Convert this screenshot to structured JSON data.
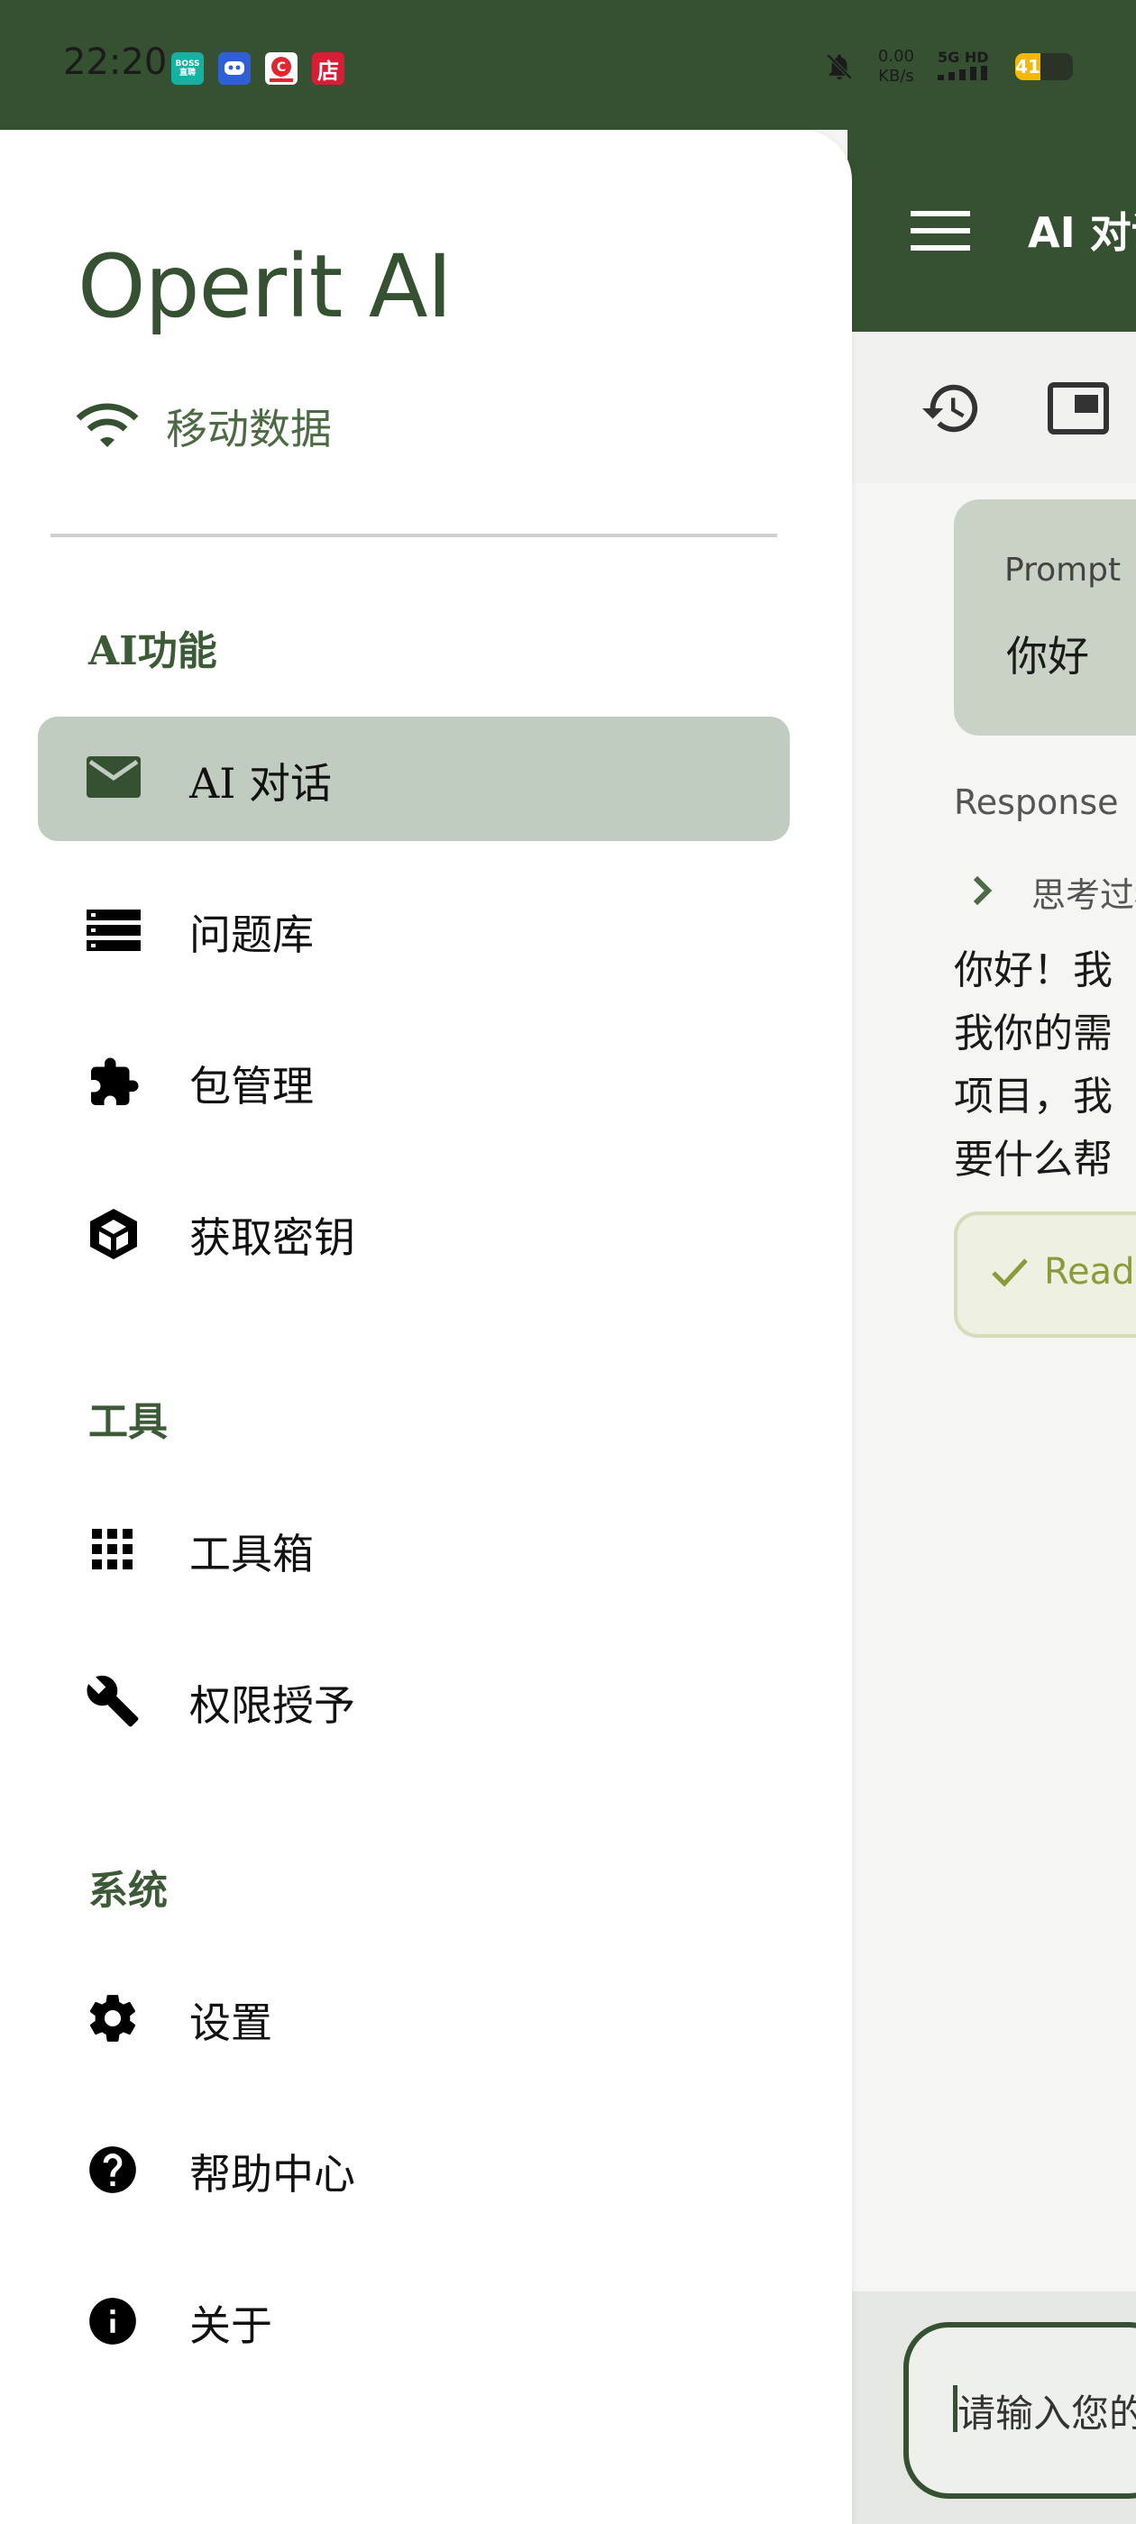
{
  "status_bar": {
    "time": "22:20",
    "apps": [
      {
        "name": "boss-app",
        "label": "BOSS 直聘",
        "color": "#12b3a3"
      },
      {
        "name": "bot-app",
        "label": "",
        "color": "#2f5fd6"
      },
      {
        "name": "red-app",
        "label": "",
        "color": "#e0262e"
      },
      {
        "name": "store-app",
        "label": "店",
        "color": "#d81e34"
      }
    ],
    "net_speed_value": "0.00",
    "net_speed_unit": "KB/s",
    "signal_label": "5G HD",
    "battery_level": "41",
    "icons": {
      "mute": "bell-off-icon",
      "signal": "signal-bars-icon",
      "battery": "battery-icon"
    }
  },
  "drawer": {
    "title": "Operit AI",
    "network": {
      "label": "移动数据",
      "icon": "wifi-icon"
    },
    "sections": [
      {
        "header": "AI功能",
        "items": [
          {
            "label": "AI 对话",
            "icon": "mail-icon",
            "active": true
          },
          {
            "label": "问题库",
            "icon": "storage-icon",
            "active": false
          },
          {
            "label": "包管理",
            "icon": "puzzle-icon",
            "active": false
          },
          {
            "label": "获取密钥",
            "icon": "cube-icon",
            "active": false
          }
        ]
      },
      {
        "header": "工具",
        "items": [
          {
            "label": "工具箱",
            "icon": "grid-icon",
            "active": false
          },
          {
            "label": "权限授予",
            "icon": "wrench-icon",
            "active": false
          }
        ]
      },
      {
        "header": "系统",
        "items": [
          {
            "label": "设置",
            "icon": "gear-icon",
            "active": false
          },
          {
            "label": "帮助中心",
            "icon": "help-icon",
            "active": false
          },
          {
            "label": "关于",
            "icon": "info-icon",
            "active": false
          }
        ]
      }
    ]
  },
  "main": {
    "title": "AI 对话",
    "toolbar_icons": [
      "history-icon",
      "window-icon"
    ],
    "prompt": {
      "label": "Prompt",
      "text": "你好"
    },
    "response": {
      "label": "Response",
      "thinking_label": "思考过程",
      "text_lines": [
        "你好！我",
        "我你的需",
        "项目，我",
        "要什么帮"
      ]
    },
    "status_chip": {
      "text": "Ready"
    },
    "input": {
      "placeholder": "请输入您的"
    }
  },
  "colors": {
    "primary": "#355131",
    "active_item": "#c0ccbf",
    "section_header": "#3d5a36",
    "ready": "#8b9a3a"
  }
}
